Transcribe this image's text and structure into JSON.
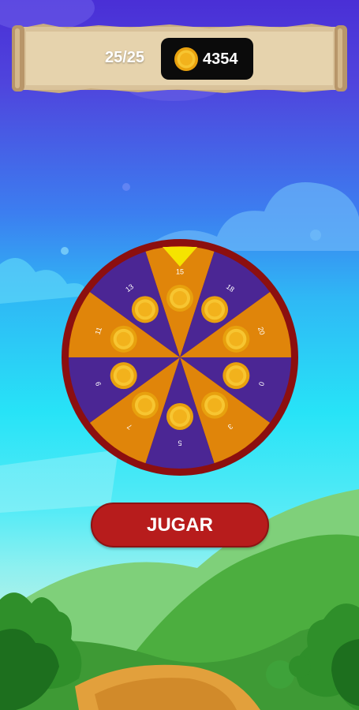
{
  "header": {
    "lives_text": "25/25",
    "coins": "4354",
    "coin_icon": "gold-coin-icon"
  },
  "wheel": {
    "segments": [
      "15",
      "18",
      "20",
      "0",
      "3",
      "5",
      "7",
      "9",
      "11",
      "13"
    ],
    "colors": {
      "orange": "#e0850a",
      "purple": "#4b2694",
      "rim": "#8c0f0f",
      "pointer": "#f5e400"
    }
  },
  "play_button": {
    "label": "JUGAR"
  }
}
